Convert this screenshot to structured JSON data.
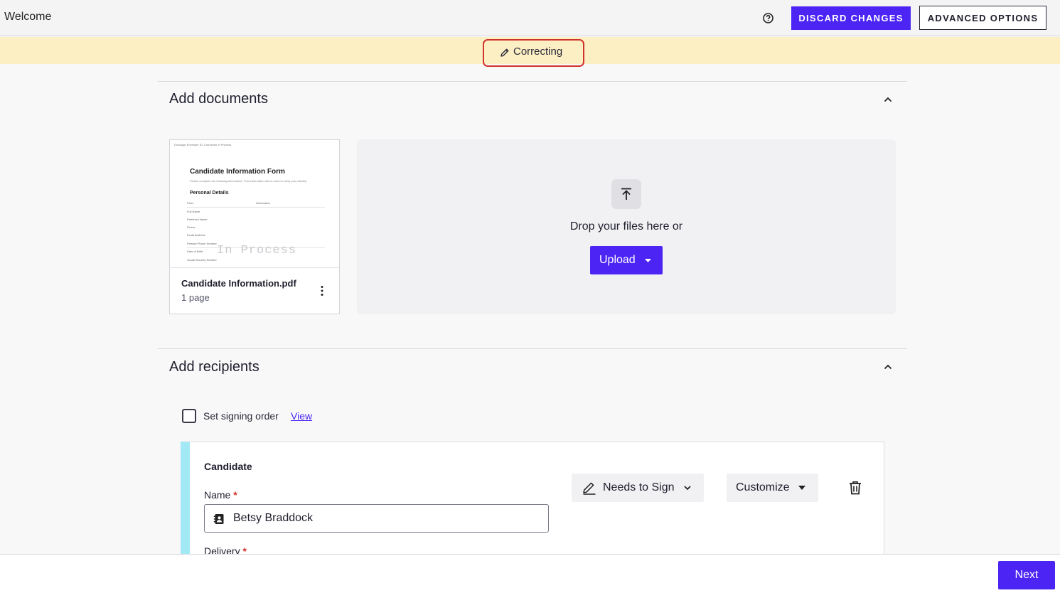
{
  "header": {
    "title": "Welcome",
    "help_icon": "help-circle-icon",
    "discard_label": "DISCARD CHANGES",
    "advanced_label": "ADVANCED OPTIONS"
  },
  "banner": {
    "status_label": "Correcting",
    "status_icon": "pencil-icon",
    "background": "#fdefc4",
    "highlight_color": "#d2322d"
  },
  "documents": {
    "section_title": "Add documents",
    "files": [
      {
        "name": "Candidate Information.pdf",
        "pages": "1 page",
        "thumbnail": {
          "header_text": "Docusign Envelope ID: Correction In Process",
          "title": "Candidate Information Form",
          "subtitle": "Please complete the following information. This information will be used to verify your identity.",
          "section": "Personal Details",
          "col_field": "Field",
          "col_info": "Information",
          "rows": [
            "Full Name",
            "Preferred Name",
            "Phone",
            "Email Address",
            "Primary Phone Number",
            "Date of Birth",
            "Social Security Number"
          ],
          "watermark": "In Process"
        }
      }
    ],
    "dropzone_text": "Drop your files here or",
    "upload_label": "Upload"
  },
  "recipients": {
    "section_title": "Add recipients",
    "signing_order_label": "Set signing order",
    "signing_order_checked": false,
    "view_link": "View",
    "list": [
      {
        "role": "Candidate",
        "name_label": "Name",
        "name_value": "Betsy Braddock",
        "delivery_label": "Delivery",
        "action_label": "Needs to Sign",
        "customize_label": "Customize",
        "accent_color": "#a3e8f5"
      }
    ]
  },
  "footer": {
    "next_label": "Next"
  },
  "colors": {
    "primary": "#4c25f5",
    "required": "#d2322d"
  }
}
